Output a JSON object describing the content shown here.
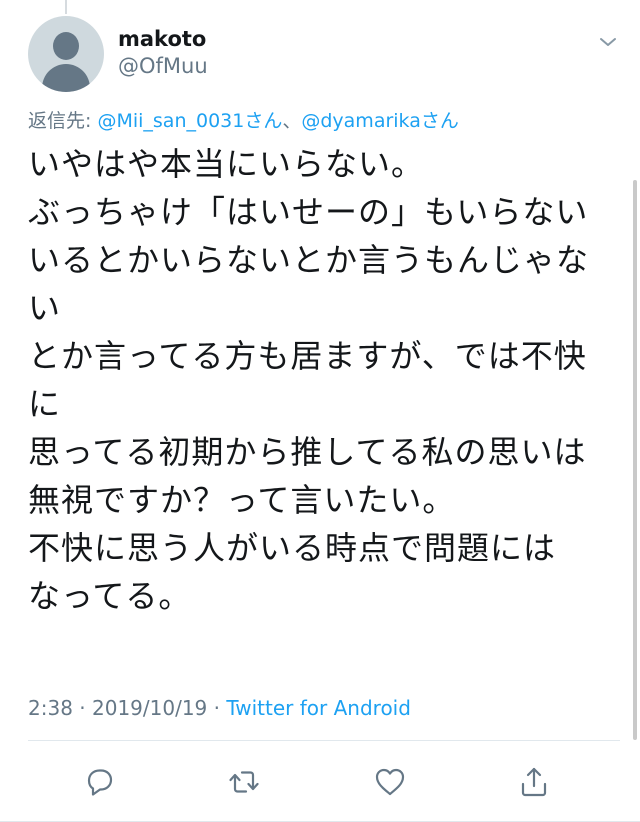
{
  "author": {
    "display_name": "makoto",
    "handle": "@OfMuu"
  },
  "reply": {
    "prefix": "返信先: ",
    "mention_1": "@Mii_san_0031さん",
    "separator": "、",
    "mention_2": "@dyamarikaさん"
  },
  "tweet": {
    "lines": [
      "いやはや本当にいらない。",
      "ぶっちゃけ「はいせーの」もいらない",
      "いるとかいらないとか言うもんじゃな",
      "い",
      "とか言ってる方も居ますが、では不快",
      "に",
      "思ってる初期から推してる私の思いは",
      "無視ですか？って言いたい。",
      "不快に思う人がいる時点で問題には",
      "なってる。"
    ]
  },
  "meta": {
    "time": "2:38",
    "dot": " · ",
    "date": "2019/10/19",
    "source": "Twitter for Android"
  },
  "icons": {
    "avatar": "default-avatar",
    "menu": "chevron-down-icon",
    "reply": "reply-icon",
    "retweet": "retweet-icon",
    "like": "heart-icon",
    "share": "share-icon"
  },
  "colors": {
    "accent": "#1da1f2",
    "secondary_text": "#657786",
    "primary_text": "#14171a"
  }
}
